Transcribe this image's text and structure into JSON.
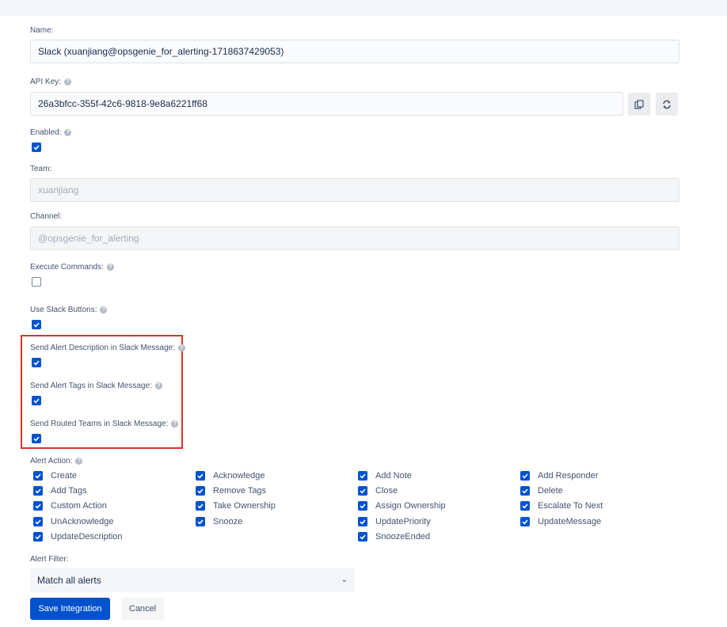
{
  "fields": {
    "name": {
      "label": "Name:",
      "value": "Slack (xuanjiang@opsgenie_for_alerting-1718637429053)"
    },
    "api_key": {
      "label": "API Key:",
      "value": "26a3bfcc-355f-42c6-9818-9e8a6221ff68",
      "copy_icon": "copy-icon",
      "refresh_icon": "refresh-icon"
    },
    "enabled": {
      "label": "Enabled:",
      "checked": true
    },
    "team": {
      "label": "Team:",
      "value": "xuanjiang"
    },
    "channel": {
      "label": "Channel:",
      "value": "@opsgenie_for_alerting"
    },
    "execute_commands": {
      "label": "Execute Commands:",
      "checked": false
    },
    "use_slack_buttons": {
      "label": "Use Slack Buttons:",
      "checked": true
    },
    "send_alert_description": {
      "label": "Send Alert Description in Slack Message:",
      "checked": true
    },
    "send_alert_tags": {
      "label": "Send Alert Tags in Slack Message:",
      "checked": true
    },
    "send_routed_teams": {
      "label": "Send Routed Teams in Slack Message:",
      "checked": true
    }
  },
  "alert_action": {
    "label": "Alert Action:",
    "items": [
      {
        "label": "Create",
        "checked": true
      },
      {
        "label": "Acknowledge",
        "checked": true
      },
      {
        "label": "Add Note",
        "checked": true
      },
      {
        "label": "Add Responder",
        "checked": true
      },
      {
        "label": "Add Tags",
        "checked": true
      },
      {
        "label": "Remove Tags",
        "checked": true
      },
      {
        "label": "Close",
        "checked": true
      },
      {
        "label": "Delete",
        "checked": true
      },
      {
        "label": "Custom Action",
        "checked": true
      },
      {
        "label": "Take Ownership",
        "checked": true
      },
      {
        "label": "Assign Ownership",
        "checked": true
      },
      {
        "label": "Escalate To Next",
        "checked": true
      },
      {
        "label": "UnAcknowledge",
        "checked": true
      },
      {
        "label": "Snooze",
        "checked": true
      },
      {
        "label": "UpdatePriority",
        "checked": true
      },
      {
        "label": "UpdateMessage",
        "checked": true
      },
      {
        "label": "UpdateDescription",
        "checked": true
      },
      {
        "label": "SnoozeEnded",
        "checked": true
      }
    ]
  },
  "alert_filter": {
    "label": "Alert Filter:",
    "value": "Match all alerts",
    "chevron": "chevron-down-icon"
  },
  "buttons": {
    "save": "Save Integration",
    "cancel": "Cancel"
  },
  "colors": {
    "primary": "#0052cc",
    "highlight": "#e03127"
  },
  "help_symbol": "?"
}
